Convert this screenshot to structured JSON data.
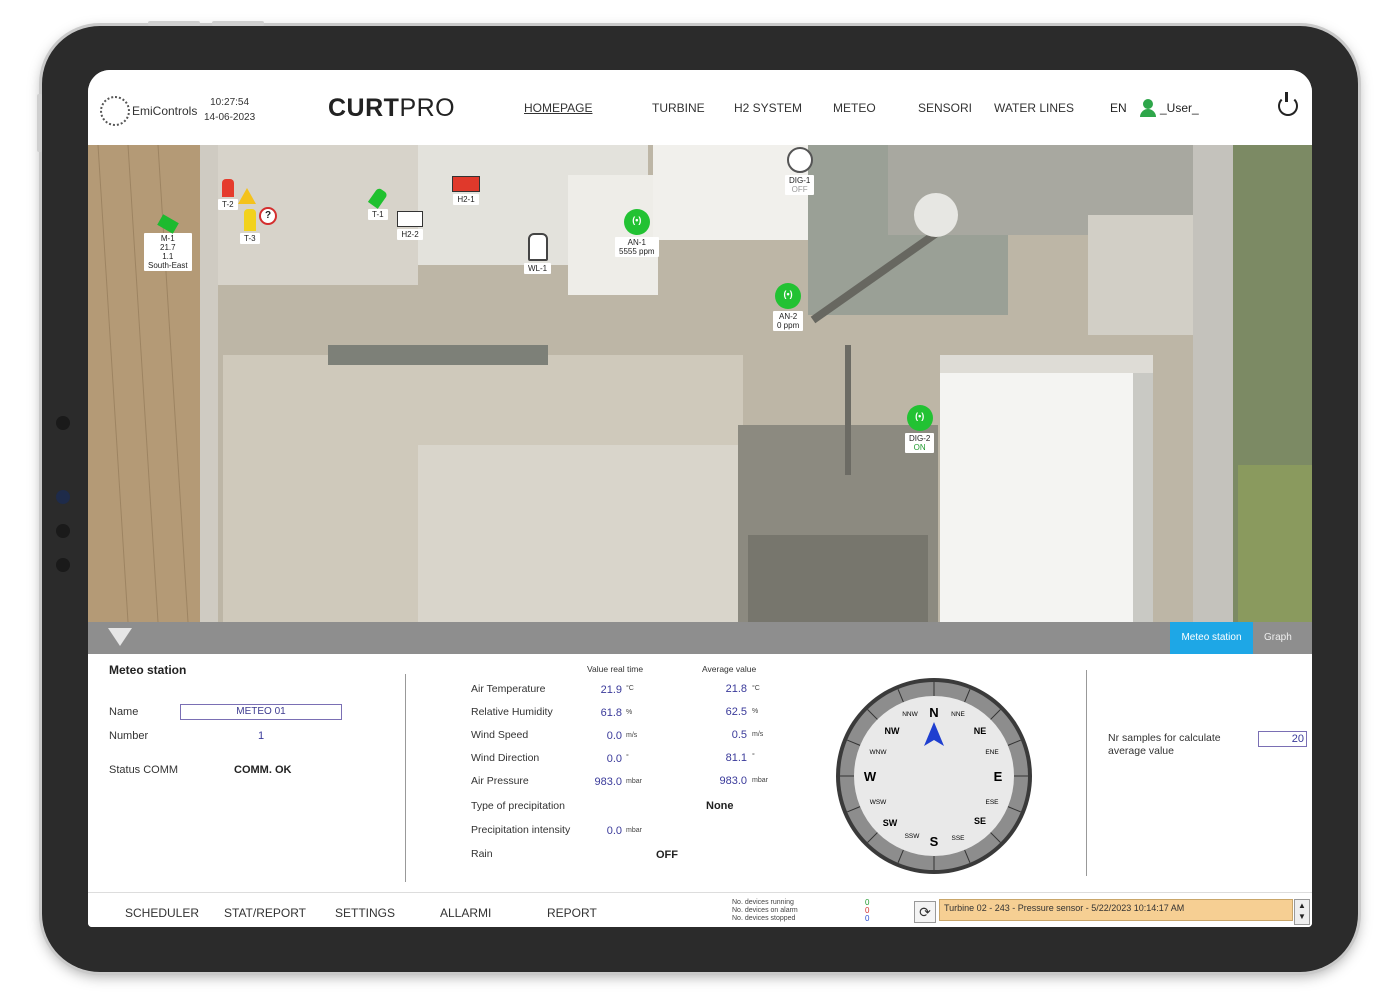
{
  "header": {
    "logo_text": "EmiControls",
    "time": "10:27:54",
    "date": "14-06-2023",
    "brand_bold": "CURT",
    "brand_light": "PRO",
    "nav": [
      "HOMEPAGE",
      "TURBINE",
      "H2 SYSTEM",
      "METEO",
      "SENSORI",
      "WATER LINES"
    ],
    "active_nav": "HOMEPAGE",
    "language": "EN",
    "user": "_User_"
  },
  "map": {
    "markers": {
      "m1": {
        "id": "M-1",
        "lines": [
          "21.7",
          "1.1",
          "South-East"
        ]
      },
      "t2": {
        "id": "T-2"
      },
      "t3": {
        "id": "T-3"
      },
      "t1": {
        "id": "T-1"
      },
      "h22": {
        "id": "H2-2"
      },
      "h21": {
        "id": "H2-1"
      },
      "wl1": {
        "id": "WL-1"
      },
      "an1": {
        "id": "AN-1",
        "value": "5555 ppm"
      },
      "an2": {
        "id": "AN-2",
        "value": "0 ppm"
      },
      "dig1": {
        "id": "DIG-1",
        "status": "OFF"
      },
      "dig2": {
        "id": "DIG-2",
        "status": "ON"
      }
    }
  },
  "tabs": {
    "meteo": "Meteo station",
    "graph": "Graph"
  },
  "panel": {
    "title": "Meteo station",
    "name_label": "Name",
    "name_value": "METEO 01",
    "number_label": "Number",
    "number_value": "1",
    "status_label": "Status COMM",
    "status_value": "COMM. OK",
    "col_real": "Value real time",
    "col_avg": "Average value",
    "rows": {
      "temp": {
        "label": "Air Temperature",
        "real": "21.9",
        "avg": "21.8",
        "unit": "°C"
      },
      "hum": {
        "label": "Relative Humidity",
        "real": "61.8",
        "avg": "62.5",
        "unit": "%"
      },
      "wind": {
        "label": "Wind Speed",
        "real": "0.0",
        "avg": "0.5",
        "unit": "m/s"
      },
      "dir": {
        "label": "Wind Direction",
        "real": "0.0",
        "avg": "81.1",
        "unit": "°"
      },
      "press": {
        "label": "Air Pressure",
        "real": "983.0",
        "avg": "983.0",
        "unit": "mbar"
      },
      "precip_type": {
        "label": "Type of precipitation",
        "avg": "None"
      },
      "precip_int": {
        "label": "Precipitation intensity",
        "real": "0.0",
        "unit": "mbar"
      },
      "rain": {
        "label": "Rain",
        "real": "OFF"
      }
    },
    "compass": {
      "N": "N",
      "S": "S",
      "E": "E",
      "W": "W",
      "NE": "NE",
      "NW": "NW",
      "SE": "SE",
      "SW": "SW",
      "NNE": "NNE",
      "NNW": "NNW",
      "ENE": "ENE",
      "ESE": "ESE",
      "SSE": "SSE",
      "SSW": "SSW",
      "WSW": "WSW",
      "WNW": "WNW",
      "needle_deg": 0
    },
    "samples_label_1": "Nr samples for calculate",
    "samples_label_2": "average value",
    "samples_value": "20"
  },
  "footer": {
    "buttons": [
      "SCHEDULER",
      "STAT/REPORT",
      "SETTINGS",
      "ALLARMI",
      "REPORT"
    ],
    "counter_labels": [
      "No. devices running",
      "No. devices on alarm",
      "No. devices stopped"
    ],
    "counter_values": [
      "0",
      "0",
      "0"
    ],
    "counter_colors": [
      "#1f9a2e",
      "#d32f2f",
      "#2a4ecf"
    ],
    "alarm_text": "Turbine 02 - 243 - Pressure sensor - 5/22/2023 10:14:17 AM"
  }
}
